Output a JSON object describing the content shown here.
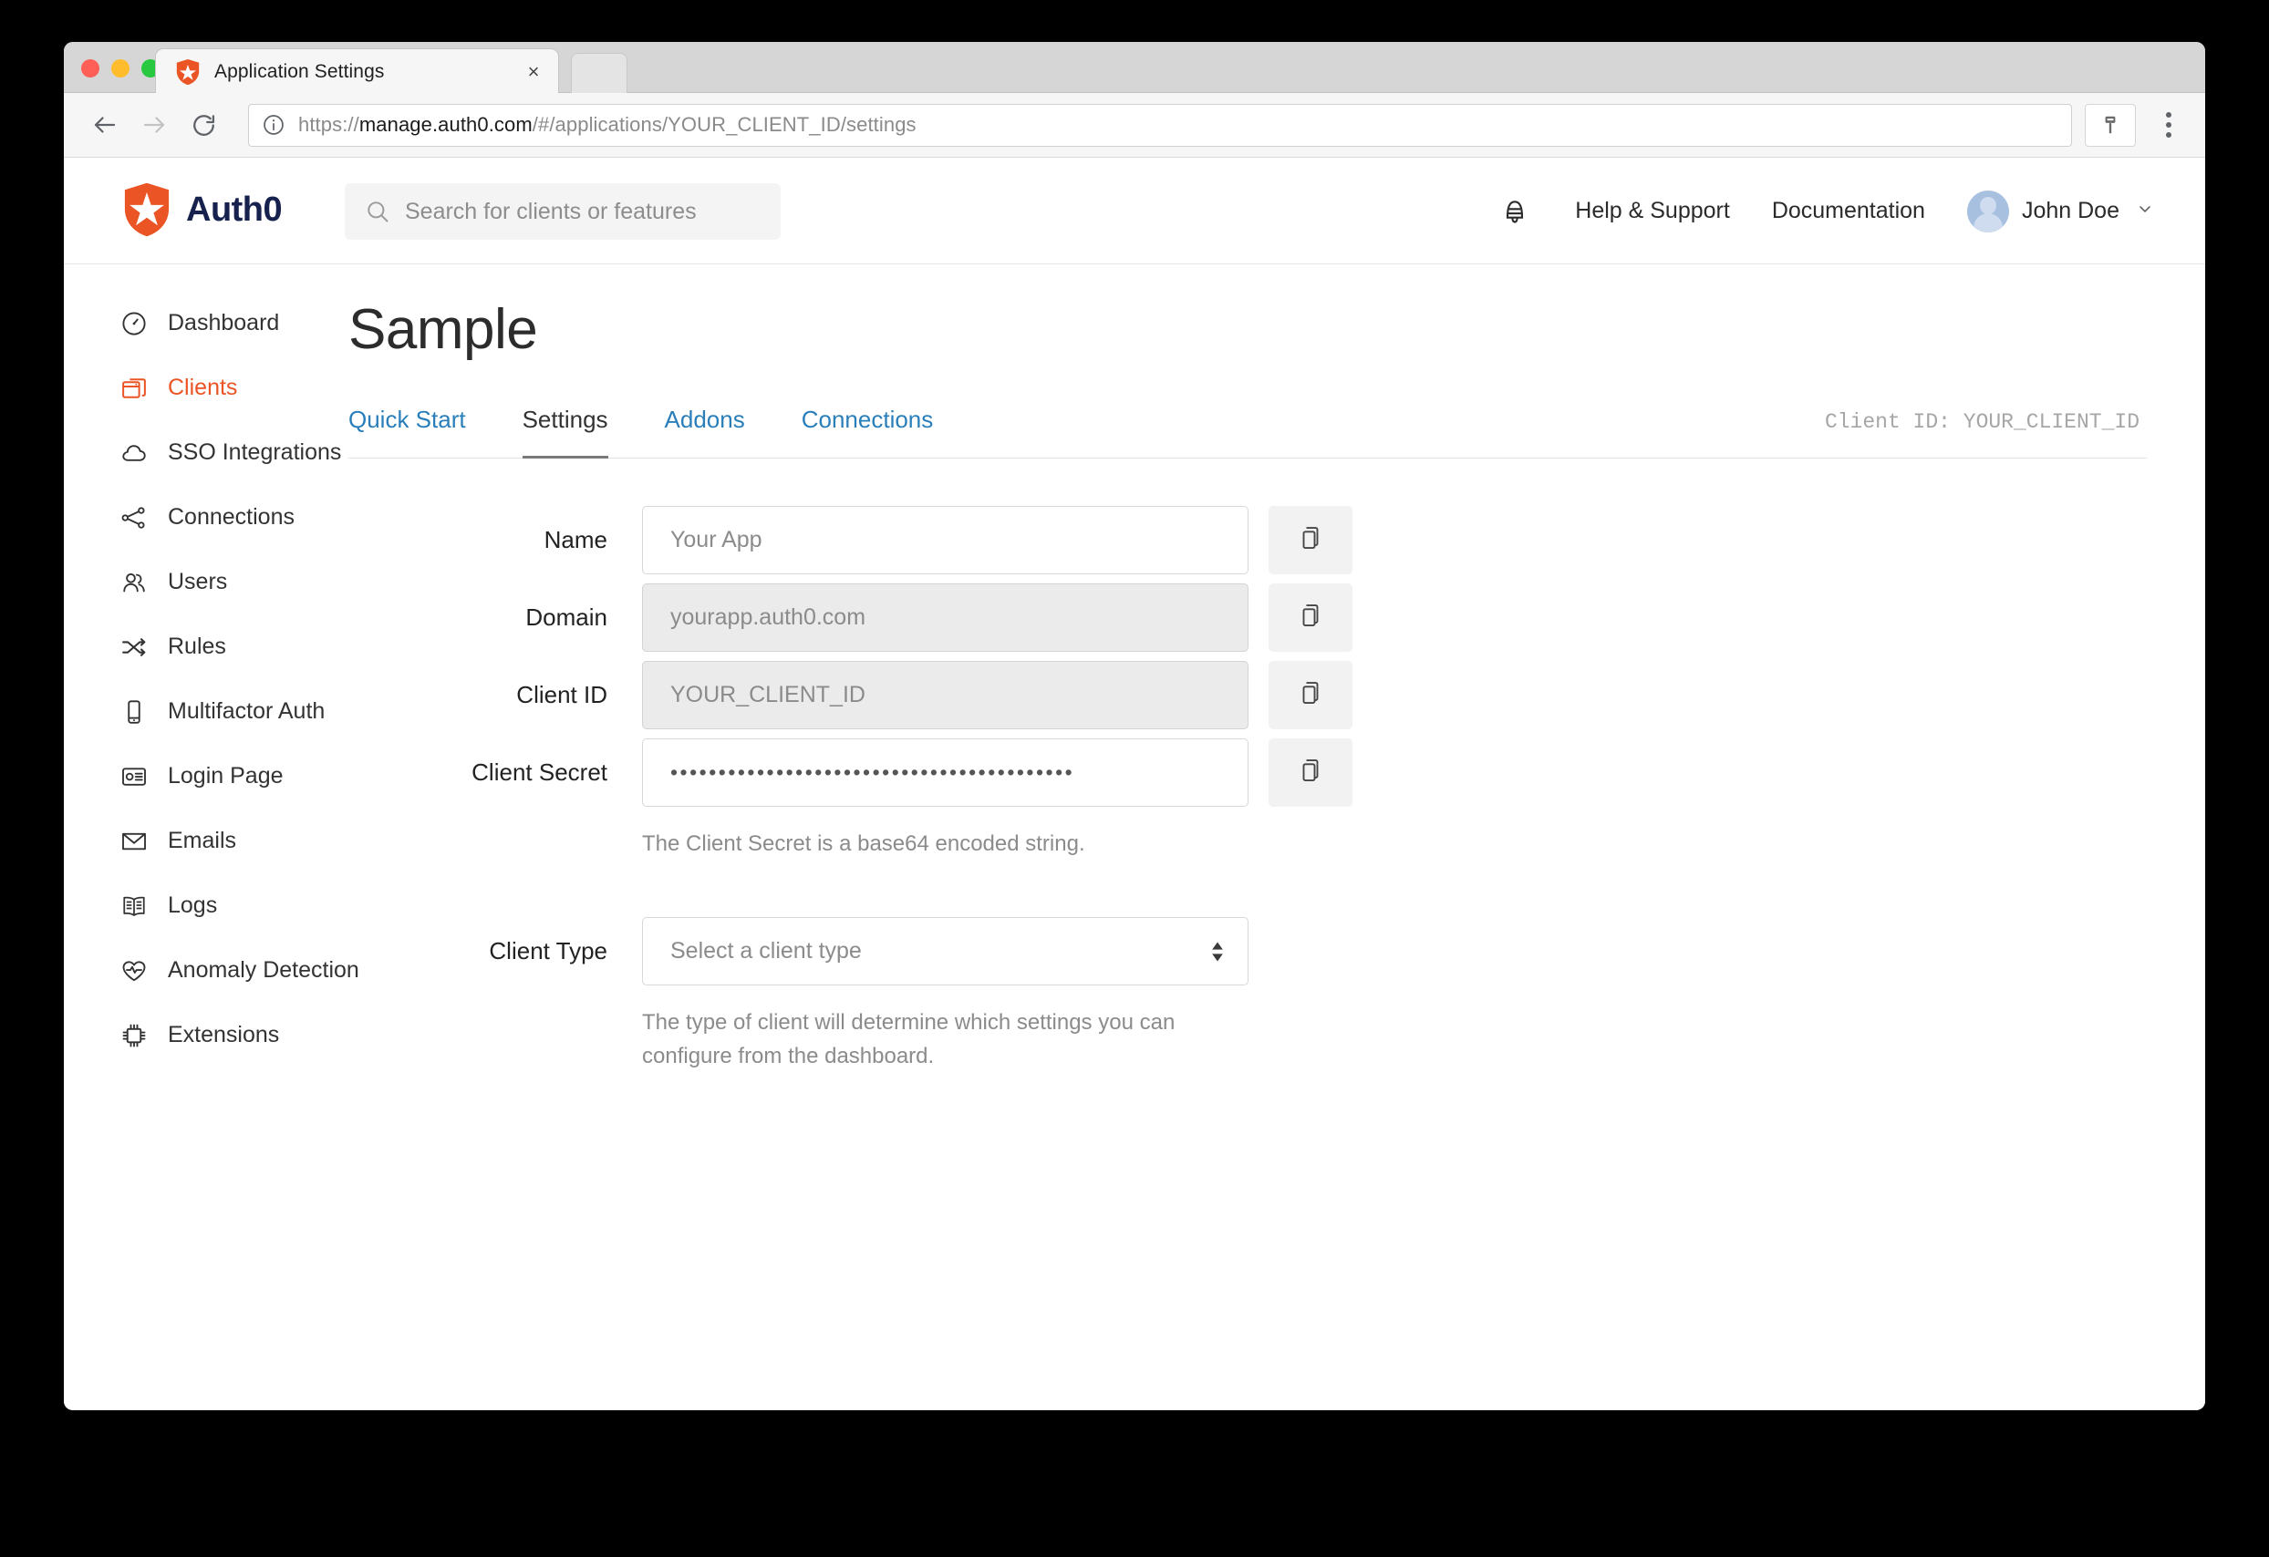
{
  "browser": {
    "tab": {
      "title": "Application Settings",
      "favicon": "auth0-shield-icon",
      "close": "×"
    },
    "address": {
      "scheme": "https://",
      "host": "manage.auth0.com",
      "path": "/#/applications/YOUR_CLIENT_ID/settings",
      "full": "https://manage.auth0.com/#/applications/YOUR_CLIENT_ID/settings"
    },
    "controls": {
      "back": "back-icon",
      "forward": "forward-icon",
      "reload": "reload-icon",
      "site_info": "info-icon",
      "save_password": "key-icon",
      "menu": "kebab-menu-icon"
    }
  },
  "header": {
    "brand": "Auth0",
    "search_placeholder": "Search for clients or features",
    "notifications_icon": "bell-icon",
    "links": [
      "Help & Support",
      "Documentation"
    ],
    "user": {
      "name": "John Doe",
      "caret": "⌄"
    }
  },
  "sidebar": {
    "items": [
      {
        "label": "Dashboard",
        "icon": "gauge-icon",
        "active": false
      },
      {
        "label": "Clients",
        "icon": "windows-stack-icon",
        "active": true
      },
      {
        "label": "SSO Integrations",
        "icon": "cloud-icon",
        "active": false
      },
      {
        "label": "Connections",
        "icon": "share-nodes-icon",
        "active": false
      },
      {
        "label": "Users",
        "icon": "users-icon",
        "active": false
      },
      {
        "label": "Rules",
        "icon": "shuffle-arrows-icon",
        "active": false
      },
      {
        "label": "Multifactor Auth",
        "icon": "mobile-phone-icon",
        "active": false
      },
      {
        "label": "Login Page",
        "icon": "id-card-icon",
        "active": false
      },
      {
        "label": "Emails",
        "icon": "envelope-icon",
        "active": false
      },
      {
        "label": "Logs",
        "icon": "open-book-icon",
        "active": false
      },
      {
        "label": "Anomaly Detection",
        "icon": "heart-pulse-icon",
        "active": false
      },
      {
        "label": "Extensions",
        "icon": "chip-icon",
        "active": false
      }
    ]
  },
  "main": {
    "title": "Sample",
    "tabs": [
      {
        "label": "Quick Start",
        "active": false
      },
      {
        "label": "Settings",
        "active": true
      },
      {
        "label": "Addons",
        "active": false
      },
      {
        "label": "Connections",
        "active": false
      }
    ],
    "client_id_note": "Client ID: YOUR_CLIENT_ID",
    "fields": {
      "name": {
        "label": "Name",
        "value": "Your App",
        "readonly": false,
        "copy_icon": "copy-icon"
      },
      "domain": {
        "label": "Domain",
        "value": "yourapp.auth0.com",
        "readonly": true,
        "copy_icon": "copy-icon"
      },
      "client_id": {
        "label": "Client ID",
        "value": "YOUR_CLIENT_ID",
        "readonly": true,
        "copy_icon": "copy-icon"
      },
      "client_secret": {
        "label": "Client Secret",
        "value": "••••••••••••••••••••••••••••••••••••••••••",
        "helper": "The Client Secret is a base64 encoded string.",
        "copy_icon": "copy-icon"
      },
      "client_type": {
        "label": "Client Type",
        "value": "Select a client type",
        "helper": "The type of client will determine which settings you can configure from the dashboard."
      }
    }
  },
  "colors": {
    "brand_orange": "#eb5424",
    "brand_navy": "#16214d",
    "link_blue": "#2a7fba",
    "muted_text": "#8b8b8b"
  }
}
